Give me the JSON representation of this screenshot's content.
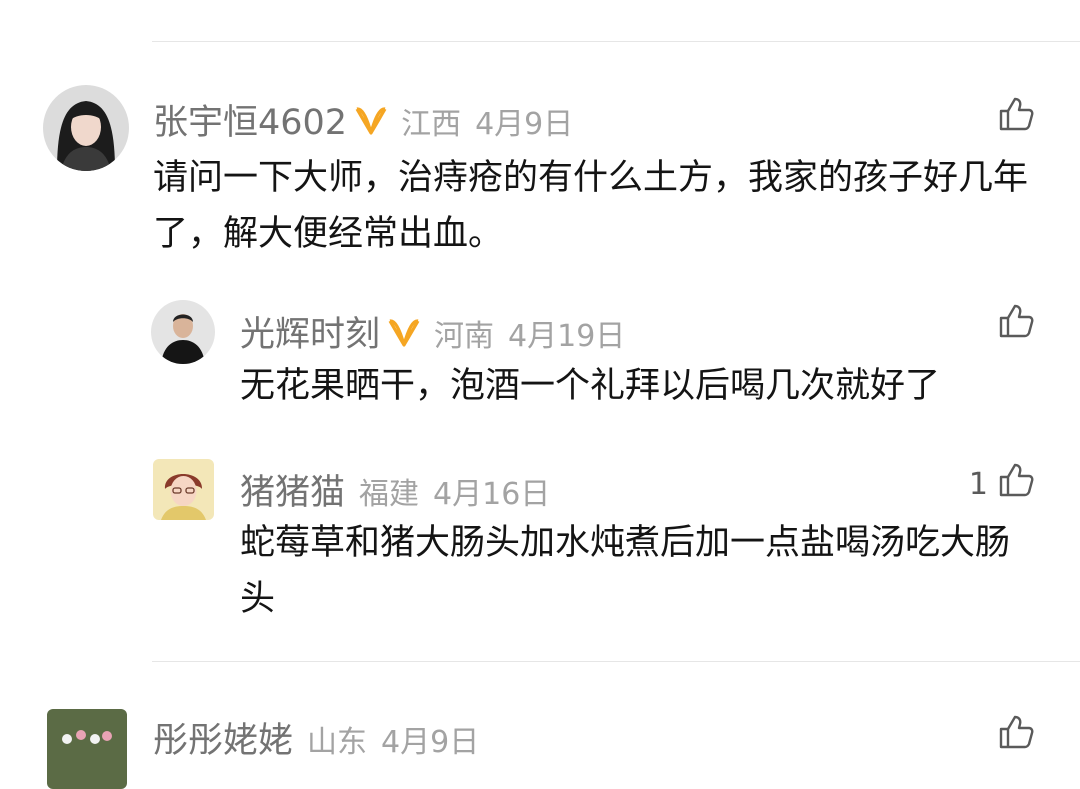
{
  "comments": [
    {
      "user": "张宇恒4602",
      "location": "江西",
      "date": "4月9日",
      "text": "请问一下大师，治痔疮的有什么土方，我家的孩子好几年了，解大便经常出血。",
      "likes": ""
    },
    {
      "user": "光辉时刻",
      "location": "河南",
      "date": "4月19日",
      "text": "无花果晒干，泡酒一个礼拜以后喝几次就好了",
      "likes": ""
    },
    {
      "user": "猪猪猫",
      "location": "福建",
      "date": "4月16日",
      "text": "蛇莓草和猪大肠头加水炖煮后加一点盐喝汤吃大肠头",
      "likes": "1"
    },
    {
      "user": "彤彤姥姥",
      "location": "山东",
      "date": "4月9日",
      "text": "",
      "likes": ""
    }
  ],
  "colors": {
    "badge": "#f5a623",
    "divider": "#e6e6e6",
    "name": "#737373",
    "meta": "#a3a3a3"
  },
  "icons": {
    "like": "thumbs-up-icon",
    "badge": "vip-badge-icon"
  }
}
